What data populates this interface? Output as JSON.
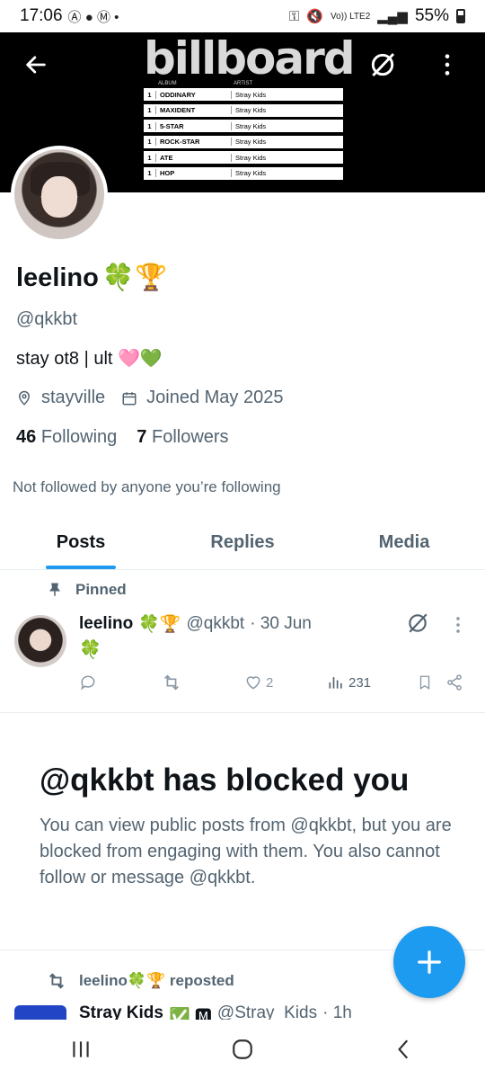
{
  "status_bar": {
    "time": "17:06",
    "battery": "55%",
    "network": "Vo)) LTE2"
  },
  "banner": {
    "logo_text": "billboard",
    "col_album": "ALBUM",
    "col_artist": "ARTIST",
    "rows": [
      {
        "rank": "1",
        "album": "ODDINARY",
        "artist": "Stray Kids"
      },
      {
        "rank": "1",
        "album": "MAXIDENT",
        "artist": "Stray Kids"
      },
      {
        "rank": "1",
        "album": "5-STAR",
        "artist": "Stray Kids"
      },
      {
        "rank": "1",
        "album": "ROCK-STAR",
        "artist": "Stray Kids"
      },
      {
        "rank": "1",
        "album": "ATE",
        "artist": "Stray Kids"
      },
      {
        "rank": "1",
        "album": "HOP",
        "artist": "Stray Kids"
      }
    ]
  },
  "profile": {
    "name": "leelino",
    "name_emojis": "🍀🏆",
    "handle": "@qkkbt",
    "bio": "stay ot8 | ult 🩷💚",
    "location": "stayville",
    "joined": "Joined May 2025",
    "following_count": "46",
    "following_label": "Following",
    "followers_count": "7",
    "followers_label": "Followers",
    "not_followed": "Not followed by anyone you’re following"
  },
  "tabs": [
    {
      "label": "Posts",
      "active": true
    },
    {
      "label": "Replies",
      "active": false
    },
    {
      "label": "Media",
      "active": false
    }
  ],
  "pinned_post": {
    "pinned_label": "Pinned",
    "name": "leelino",
    "name_emojis": "🍀🏆",
    "handle": "@qkkbt",
    "date": "· 30 Jun",
    "body": "🍀",
    "likes": "2",
    "views": "231"
  },
  "blocked": {
    "title": "@qkkbt has blocked you",
    "text": "You can view public posts from @qkkbt, but you are blocked from engaging with them. You also cannot follow or message @qkkbt."
  },
  "repost": {
    "label": "leelino🍀🏆 reposted",
    "name": "Stray Kids",
    "badges": "✅ 🅼",
    "handle": "@Stray_Kids",
    "time": "· 1h"
  },
  "colors": {
    "accent": "#1d9bf0",
    "muted": "#536471"
  }
}
